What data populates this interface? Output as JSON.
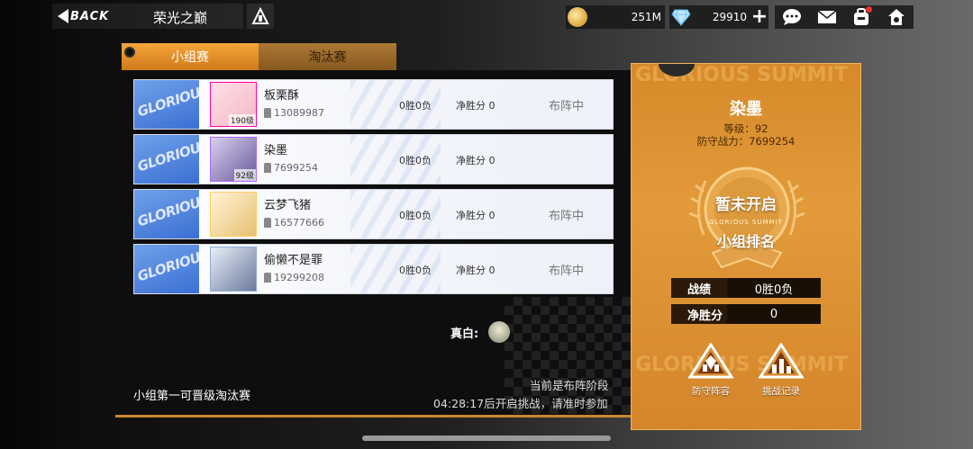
{
  "header": {
    "back_label": "BACK",
    "title": "荣光之巅"
  },
  "currency": {
    "coins": "251M",
    "gems": "29910"
  },
  "tabs": [
    {
      "label": "小组赛",
      "active": true
    },
    {
      "label": "淘汰赛",
      "active": false
    }
  ],
  "badge_text": "GLORIOUS",
  "players": [
    {
      "name": "板栗酥",
      "power": "13089987",
      "level": "190级",
      "record": "0胜0负",
      "net": "净胜分 0",
      "state": "布阵中"
    },
    {
      "name": "染墨",
      "power": "7699254",
      "level": "92级",
      "record": "0胜0负",
      "net": "净胜分 0",
      "state": ""
    },
    {
      "name": "云梦飞猪",
      "power": "16577666",
      "level": "",
      "record": "0胜0负",
      "net": "净胜分 0",
      "state": "布阵中"
    },
    {
      "name": "偷懒不是罪",
      "power": "19299208",
      "level": "",
      "record": "0胜0负",
      "net": "净胜分 0",
      "state": "布阵中"
    }
  ],
  "cheer": {
    "label": "真白:"
  },
  "footer": {
    "note": "小组第一可晋级淘汰赛",
    "phase": "当前是布阵阶段",
    "countdown": "04:28:17后开启挑战，请准时参加"
  },
  "card": {
    "watermark": "GLORIOUS SUMMIT",
    "name": "染墨",
    "level": "等级：92",
    "power": "防守战力：7699254",
    "medal_title": "暂未开启",
    "medal_sub": "GLORIOUS SUMMIT",
    "medal_rank": "小组排名",
    "stats": [
      {
        "label": "战绩",
        "value": "0胜0负"
      },
      {
        "label": "净胜分",
        "value": "0"
      }
    ],
    "actions": [
      {
        "label": "防守阵容",
        "icon": "defense-lineup-icon"
      },
      {
        "label": "挑战记录",
        "icon": "challenge-record-icon"
      }
    ]
  },
  "colors": {
    "accent": "#e29a3a",
    "tab_active": "#f5a63b",
    "badge_blue": "#3c6fd4"
  }
}
